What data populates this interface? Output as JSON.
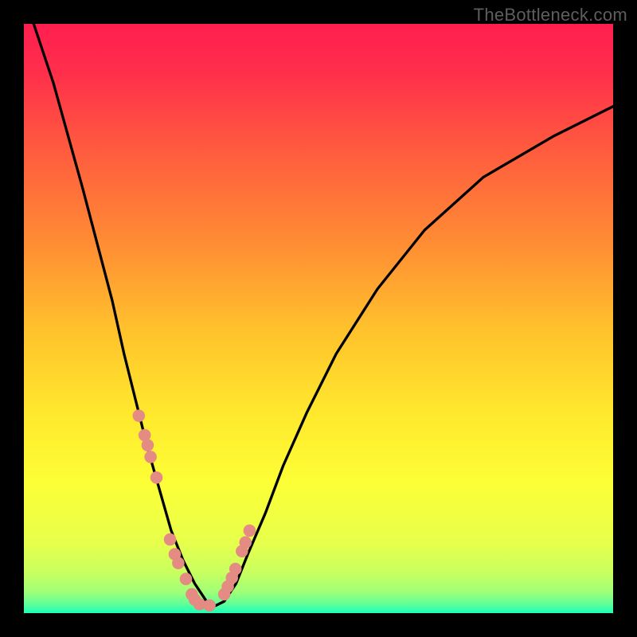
{
  "watermark": "TheBottleneck.com",
  "chart_data": {
    "type": "line",
    "title": "",
    "xlabel": "",
    "ylabel": "",
    "xlim": [
      0,
      100
    ],
    "ylim": [
      0,
      100
    ],
    "series": [
      {
        "name": "bottleneck-curve",
        "x": [
          0,
          5,
          10,
          15,
          17,
          19,
          21,
          23,
          25,
          27,
          29,
          31,
          32,
          34,
          36,
          38,
          41,
          44,
          48,
          53,
          60,
          68,
          78,
          90,
          100
        ],
        "y": [
          105,
          90,
          72,
          53,
          44,
          36,
          28,
          21,
          14,
          9,
          5,
          2,
          1,
          2,
          5,
          10,
          17,
          25,
          34,
          44,
          55,
          65,
          74,
          81,
          86
        ]
      }
    ],
    "markers": {
      "name": "measured-points",
      "x": [
        19.5,
        20.5,
        21.0,
        21.5,
        22.5,
        24.8,
        25.6,
        26.2,
        27.5,
        28.5,
        29.0,
        29.8,
        31.5,
        34.0,
        34.6,
        35.3,
        35.9,
        37.0,
        37.6,
        38.3
      ],
      "y": [
        33.5,
        30.2,
        28.5,
        26.5,
        23.0,
        12.5,
        10.0,
        8.5,
        5.8,
        3.2,
        2.3,
        1.5,
        1.3,
        3.2,
        4.5,
        6.0,
        7.5,
        10.5,
        12.0,
        14.0
      ]
    },
    "gradient_bands": [
      {
        "stop": 0.0,
        "color": "#ff1e4f"
      },
      {
        "stop": 0.08,
        "color": "#ff2e4b"
      },
      {
        "stop": 0.22,
        "color": "#ff5d3e"
      },
      {
        "stop": 0.38,
        "color": "#ff8f33"
      },
      {
        "stop": 0.52,
        "color": "#ffc22c"
      },
      {
        "stop": 0.66,
        "color": "#ffe82d"
      },
      {
        "stop": 0.78,
        "color": "#fcff36"
      },
      {
        "stop": 0.88,
        "color": "#e7ff4b"
      },
      {
        "stop": 0.93,
        "color": "#c9ff5f"
      },
      {
        "stop": 0.965,
        "color": "#9fff78"
      },
      {
        "stop": 0.985,
        "color": "#5dff9a"
      },
      {
        "stop": 1.0,
        "color": "#1bffba"
      }
    ],
    "curve_color": "#000000",
    "marker_color": "#e48b84"
  }
}
